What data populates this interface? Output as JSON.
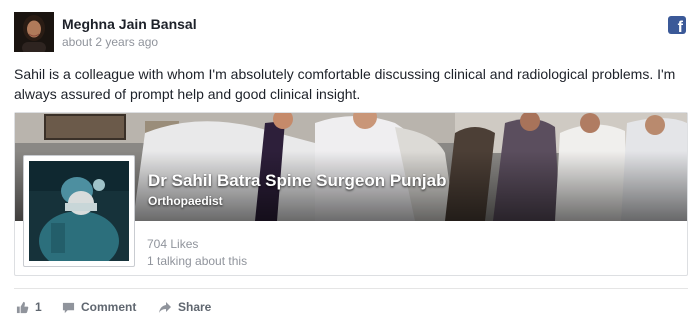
{
  "post": {
    "author": "Meghna Jain Bansal",
    "time": "about 2 years ago",
    "text": "Sahil is a colleague with whom I'm absolutely comfortable discussing clinical and radiological problems. I'm always assured of prompt help and good clinical insight."
  },
  "page_preview": {
    "name": "Dr Sahil Batra Spine Surgeon Punjab",
    "category": "Orthopaedist",
    "likes": "704 Likes",
    "talking": "1 talking about this"
  },
  "actions": {
    "like_count": "1",
    "comment_label": "Comment",
    "share_label": "Share"
  },
  "icons": {
    "platform": "facebook-icon",
    "like": "thumbs-up-icon",
    "comment": "speech-bubble-icon",
    "share": "share-arrow-icon"
  },
  "colors": {
    "facebook_blue": "#3b5998",
    "text": "#1d2129",
    "muted": "#90949c",
    "action": "#606770"
  }
}
